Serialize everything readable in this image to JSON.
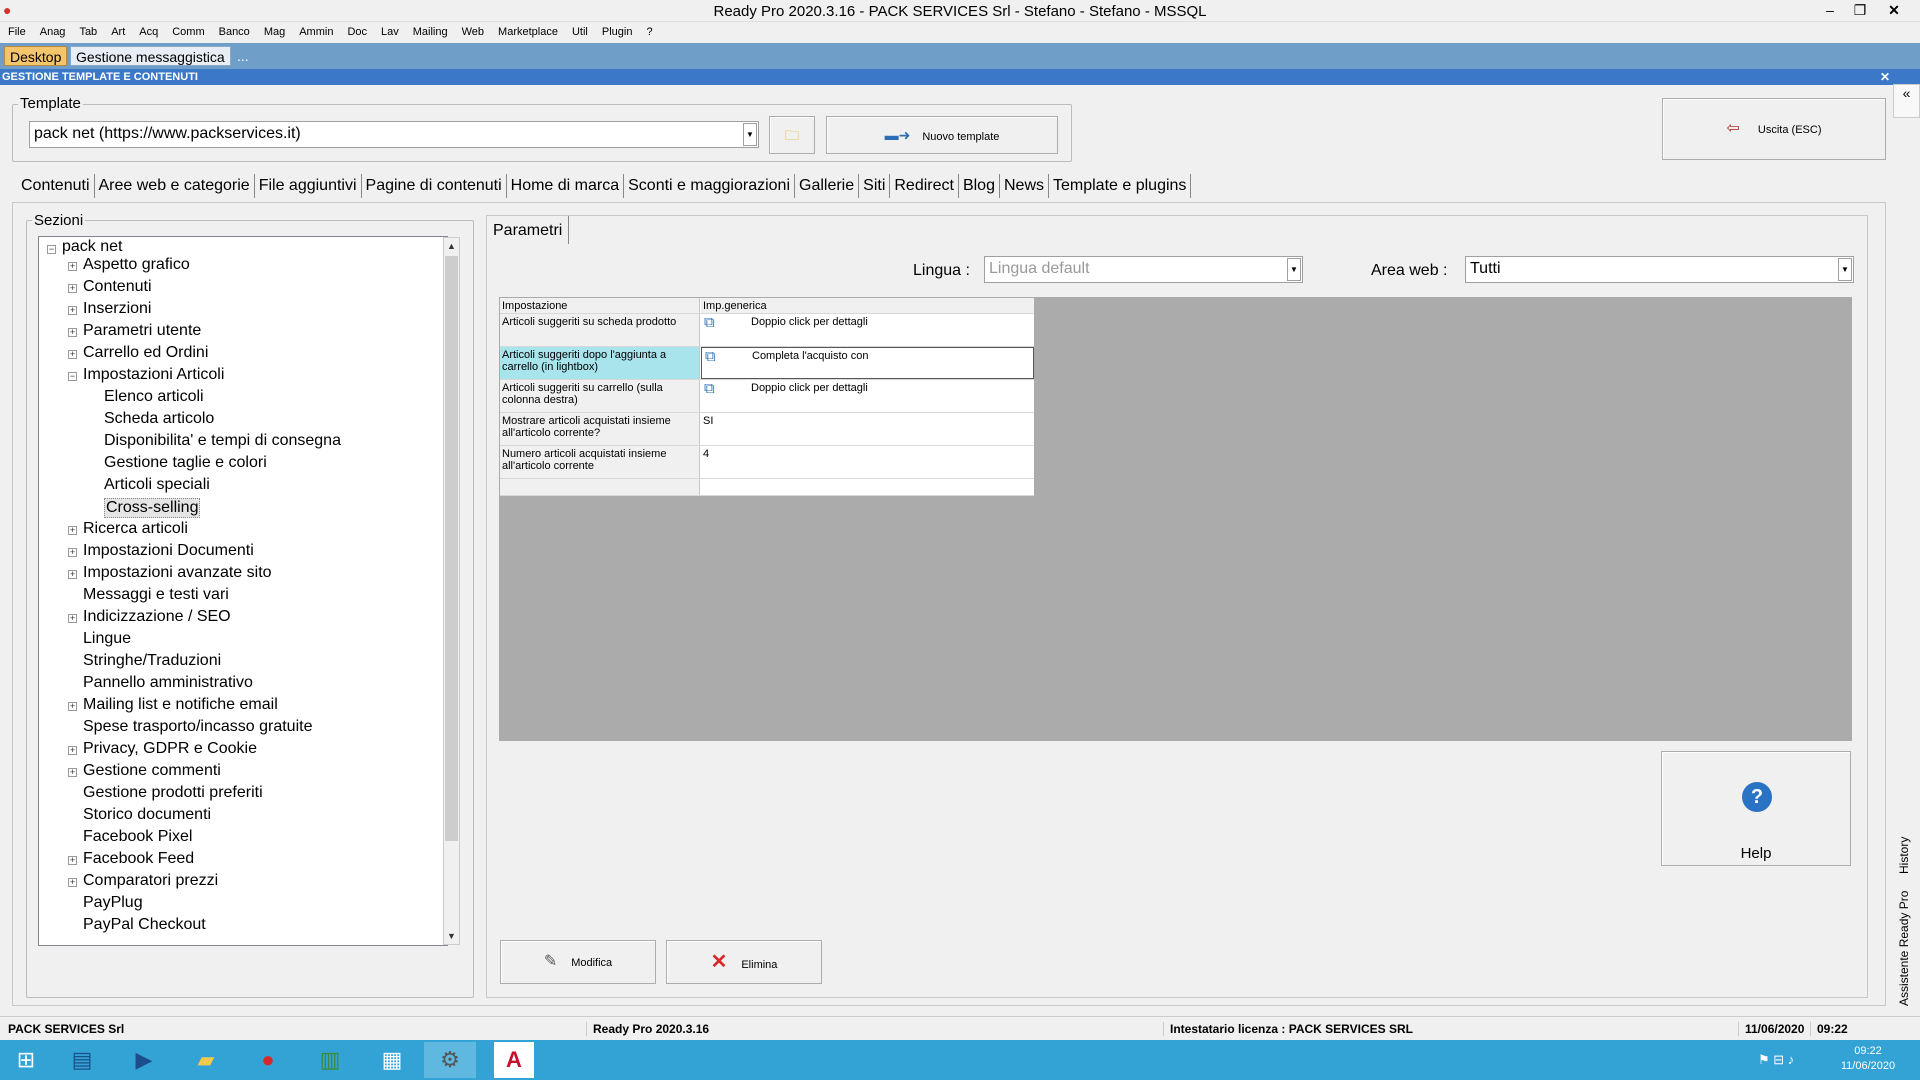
{
  "window": {
    "title": "Ready Pro 2020.3.16 - PACK SERVICES Srl - Stefano - Stefano - MSSQL"
  },
  "menu": [
    "File",
    "Anag",
    "Tab",
    "Art",
    "Acq",
    "Comm",
    "Banco",
    "Mag",
    "Ammin",
    "Doc",
    "Lav",
    "Mailing",
    "Web",
    "Marketplace",
    "Util",
    "Plugin",
    "?"
  ],
  "doctabs": {
    "desktop": "Desktop",
    "gestione": "Gestione messaggistica",
    "more": "..."
  },
  "header": {
    "title": "GESTIONE TEMPLATE E CONTENUTI"
  },
  "template": {
    "group_label": "Template",
    "value": "pack net (https://www.packservices.it)",
    "new_label": "Nuovo template"
  },
  "exit": {
    "label": "Uscita (ESC)"
  },
  "tabs": [
    "Contenuti",
    "Aree web e categorie",
    "File aggiuntivi",
    "Pagine di contenuti",
    "Home di marca",
    "Sconti e maggiorazioni",
    "Gallerie",
    "Siti",
    "Redirect",
    "Blog",
    "News",
    "Template e plugins"
  ],
  "sections": {
    "label": "Sezioni",
    "root": "pack net",
    "items": [
      {
        "label": "Aspetto grafico",
        "level": 1,
        "exp": "+"
      },
      {
        "label": "Contenuti",
        "level": 1,
        "exp": "+"
      },
      {
        "label": "Inserzioni",
        "level": 1,
        "exp": "+"
      },
      {
        "label": "Parametri utente",
        "level": 1,
        "exp": "+"
      },
      {
        "label": "Carrello ed Ordini",
        "level": 1,
        "exp": "+"
      },
      {
        "label": "Impostazioni Articoli",
        "level": 1,
        "exp": "−"
      },
      {
        "label": "Elenco articoli",
        "level": 2,
        "exp": ""
      },
      {
        "label": "Scheda articolo",
        "level": 2,
        "exp": ""
      },
      {
        "label": "Disponibilita' e tempi di consegna",
        "level": 2,
        "exp": ""
      },
      {
        "label": "Gestione taglie e colori",
        "level": 2,
        "exp": ""
      },
      {
        "label": "Articoli speciali",
        "level": 2,
        "exp": ""
      },
      {
        "label": "Cross-selling",
        "level": 2,
        "exp": "",
        "selected": true
      },
      {
        "label": "Ricerca articoli",
        "level": 1,
        "exp": "+"
      },
      {
        "label": "Impostazioni Documenti",
        "level": 1,
        "exp": "+"
      },
      {
        "label": "Impostazioni avanzate sito",
        "level": 1,
        "exp": "+"
      },
      {
        "label": "Messaggi e testi vari",
        "level": 1,
        "exp": ""
      },
      {
        "label": "Indicizzazione / SEO",
        "level": 1,
        "exp": "+"
      },
      {
        "label": "Lingue",
        "level": 1,
        "exp": ""
      },
      {
        "label": "Stringhe/Traduzioni",
        "level": 1,
        "exp": ""
      },
      {
        "label": "Pannello amministrativo",
        "level": 1,
        "exp": ""
      },
      {
        "label": "Mailing list e notifiche email",
        "level": 1,
        "exp": "+"
      },
      {
        "label": "Spese trasporto/incasso gratuite",
        "level": 1,
        "exp": ""
      },
      {
        "label": "Privacy, GDPR e Cookie",
        "level": 1,
        "exp": "+"
      },
      {
        "label": "Gestione commenti",
        "level": 1,
        "exp": "+"
      },
      {
        "label": "Gestione prodotti preferiti",
        "level": 1,
        "exp": ""
      },
      {
        "label": "Storico documenti",
        "level": 1,
        "exp": ""
      },
      {
        "label": "Facebook Pixel",
        "level": 1,
        "exp": ""
      },
      {
        "label": "Facebook Feed",
        "level": 1,
        "exp": "+"
      },
      {
        "label": "Comparatori prezzi",
        "level": 1,
        "exp": "+"
      },
      {
        "label": "PayPlug",
        "level": 1,
        "exp": ""
      },
      {
        "label": "PayPal Checkout",
        "level": 1,
        "exp": ""
      }
    ]
  },
  "params": {
    "tab": "Parametri",
    "lingua_label": "Lingua :",
    "lingua_value": "Lingua default",
    "area_label": "Area web :",
    "area_value": "Tutti",
    "col1": "Impostazione",
    "col2": "Imp.generica",
    "rows": [
      {
        "name": "Articoli suggeriti su scheda prodotto",
        "value": "Doppio click per dettagli",
        "icon": true
      },
      {
        "name": "Articoli suggeriti dopo l'aggiunta a carrello (in lightbox)",
        "value": "Completa l'acquisto con",
        "icon": true,
        "selected": true
      },
      {
        "name": "Articoli suggeriti su carrello (sulla colonna destra)",
        "value": "Doppio click per dettagli",
        "icon": true
      },
      {
        "name": "Mostrare articoli acquistati insieme all'articolo corrente?",
        "value": "SI",
        "icon": false
      },
      {
        "name": "Numero articoli acquistati insieme all'articolo corrente",
        "value": "4",
        "icon": false
      }
    ]
  },
  "help": {
    "label": "Help"
  },
  "actions": {
    "modifica": "Modifica",
    "elimina": "Elimina"
  },
  "side": {
    "history": "History",
    "assistente": "Assistente Ready Pro"
  },
  "status": {
    "company": "PACK SERVICES Srl",
    "version": "Ready Pro 2020.3.16",
    "license": "Intestatario licenza : PACK SERVICES SRL",
    "date": "11/06/2020",
    "time": "09:22"
  },
  "tray": {
    "time": "09:22",
    "date": "11/06/2020"
  },
  "colors": {
    "accent": "#3c78c8",
    "selected_row": "#a8e4ec",
    "grid_bg": "#ababab",
    "taskbar": "#33a3d6",
    "desktop_tab": "#f5c56b"
  }
}
